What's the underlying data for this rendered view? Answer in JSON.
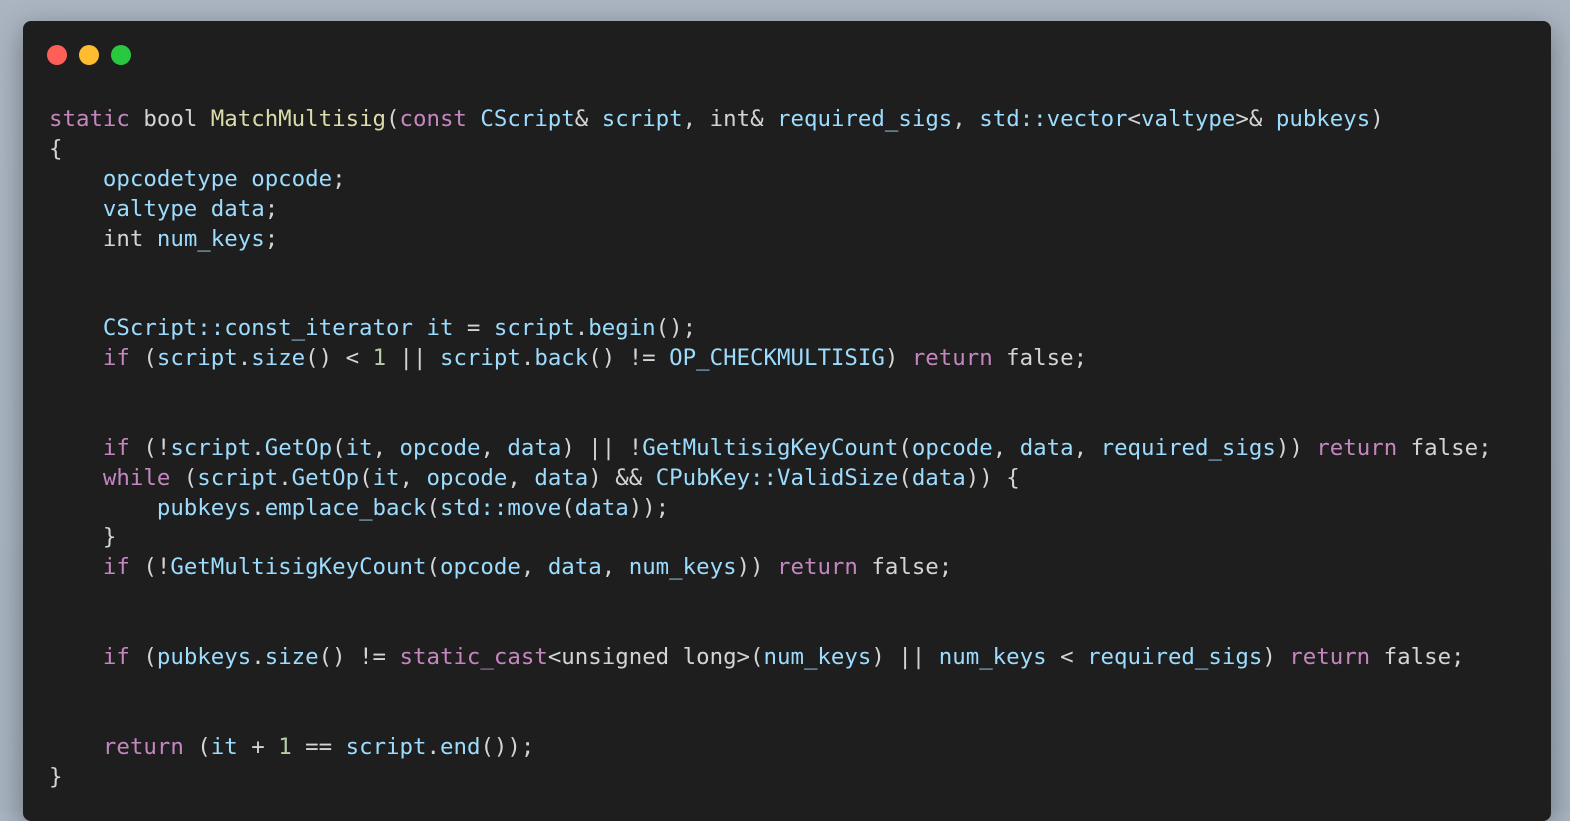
{
  "window": {
    "dots": [
      {
        "name": "close",
        "color": "#ff5f57"
      },
      {
        "name": "minimize",
        "color": "#febc2e"
      },
      {
        "name": "zoom",
        "color": "#28c840"
      }
    ]
  },
  "code": {
    "language": "cpp",
    "lines": [
      [
        [
          "keyword",
          "static"
        ],
        [
          "plain",
          " "
        ],
        [
          "type",
          "bool"
        ],
        [
          "plain",
          " "
        ],
        [
          "func",
          "MatchMultisig"
        ],
        [
          "plain",
          "("
        ],
        [
          "keyword",
          "const"
        ],
        [
          "plain",
          " "
        ],
        [
          "class",
          "CScript"
        ],
        [
          "plain",
          "& "
        ],
        [
          "var",
          "script"
        ],
        [
          "plain",
          ", "
        ],
        [
          "type",
          "int"
        ],
        [
          "plain",
          "& "
        ],
        [
          "var",
          "required_sigs"
        ],
        [
          "plain",
          ", "
        ],
        [
          "class",
          "std::vector"
        ],
        [
          "plain",
          "<"
        ],
        [
          "class",
          "valtype"
        ],
        [
          "plain",
          ">& "
        ],
        [
          "var",
          "pubkeys"
        ],
        [
          "plain",
          ")"
        ]
      ],
      [
        [
          "plain",
          "{"
        ]
      ],
      [
        [
          "plain",
          "    "
        ],
        [
          "class",
          "opcodetype"
        ],
        [
          "plain",
          " "
        ],
        [
          "var",
          "opcode"
        ],
        [
          "plain",
          ";"
        ]
      ],
      [
        [
          "plain",
          "    "
        ],
        [
          "class",
          "valtype"
        ],
        [
          "plain",
          " "
        ],
        [
          "var",
          "data"
        ],
        [
          "plain",
          ";"
        ]
      ],
      [
        [
          "plain",
          "    "
        ],
        [
          "type",
          "int"
        ],
        [
          "plain",
          " "
        ],
        [
          "var",
          "num_keys"
        ],
        [
          "plain",
          ";"
        ]
      ],
      [],
      [],
      [
        [
          "plain",
          "    "
        ],
        [
          "class",
          "CScript::const_iterator"
        ],
        [
          "plain",
          " "
        ],
        [
          "var",
          "it"
        ],
        [
          "plain",
          " = "
        ],
        [
          "var",
          "script"
        ],
        [
          "plain",
          "."
        ],
        [
          "var",
          "begin"
        ],
        [
          "plain",
          "();"
        ]
      ],
      [
        [
          "plain",
          "    "
        ],
        [
          "keyword",
          "if"
        ],
        [
          "plain",
          " ("
        ],
        [
          "var",
          "script"
        ],
        [
          "plain",
          "."
        ],
        [
          "var",
          "size"
        ],
        [
          "plain",
          "() < "
        ],
        [
          "num",
          "1"
        ],
        [
          "plain",
          " || "
        ],
        [
          "var",
          "script"
        ],
        [
          "plain",
          "."
        ],
        [
          "var",
          "back"
        ],
        [
          "plain",
          "() != "
        ],
        [
          "const",
          "OP_CHECKMULTISIG"
        ],
        [
          "plain",
          ") "
        ],
        [
          "keyword",
          "return"
        ],
        [
          "plain",
          " false;"
        ]
      ],
      [],
      [],
      [
        [
          "plain",
          "    "
        ],
        [
          "keyword",
          "if"
        ],
        [
          "plain",
          " (!"
        ],
        [
          "var",
          "script"
        ],
        [
          "plain",
          "."
        ],
        [
          "var",
          "GetOp"
        ],
        [
          "plain",
          "("
        ],
        [
          "var",
          "it"
        ],
        [
          "plain",
          ", "
        ],
        [
          "var",
          "opcode"
        ],
        [
          "plain",
          ", "
        ],
        [
          "var",
          "data"
        ],
        [
          "plain",
          ") || !"
        ],
        [
          "var",
          "GetMultisigKeyCount"
        ],
        [
          "plain",
          "("
        ],
        [
          "var",
          "opcode"
        ],
        [
          "plain",
          ", "
        ],
        [
          "var",
          "data"
        ],
        [
          "plain",
          ", "
        ],
        [
          "var",
          "required_sigs"
        ],
        [
          "plain",
          ")) "
        ],
        [
          "keyword",
          "return"
        ],
        [
          "plain",
          " false;"
        ]
      ],
      [
        [
          "plain",
          "    "
        ],
        [
          "keyword",
          "while"
        ],
        [
          "plain",
          " ("
        ],
        [
          "var",
          "script"
        ],
        [
          "plain",
          "."
        ],
        [
          "var",
          "GetOp"
        ],
        [
          "plain",
          "("
        ],
        [
          "var",
          "it"
        ],
        [
          "plain",
          ", "
        ],
        [
          "var",
          "opcode"
        ],
        [
          "plain",
          ", "
        ],
        [
          "var",
          "data"
        ],
        [
          "plain",
          ") && "
        ],
        [
          "class",
          "CPubKey::ValidSize"
        ],
        [
          "plain",
          "("
        ],
        [
          "var",
          "data"
        ],
        [
          "plain",
          ")) {"
        ]
      ],
      [
        [
          "plain",
          "        "
        ],
        [
          "var",
          "pubkeys"
        ],
        [
          "plain",
          "."
        ],
        [
          "var",
          "emplace_back"
        ],
        [
          "plain",
          "("
        ],
        [
          "var",
          "std::move"
        ],
        [
          "plain",
          "("
        ],
        [
          "var",
          "data"
        ],
        [
          "plain",
          "));"
        ]
      ],
      [
        [
          "plain",
          "    }"
        ]
      ],
      [
        [
          "plain",
          "    "
        ],
        [
          "keyword",
          "if"
        ],
        [
          "plain",
          " (!"
        ],
        [
          "var",
          "GetMultisigKeyCount"
        ],
        [
          "plain",
          "("
        ],
        [
          "var",
          "opcode"
        ],
        [
          "plain",
          ", "
        ],
        [
          "var",
          "data"
        ],
        [
          "plain",
          ", "
        ],
        [
          "var",
          "num_keys"
        ],
        [
          "plain",
          "))"
        ],
        [
          "plain",
          " "
        ],
        [
          "keyword",
          "return"
        ],
        [
          "plain",
          " false;"
        ]
      ],
      [],
      [],
      [
        [
          "plain",
          "    "
        ],
        [
          "keyword",
          "if"
        ],
        [
          "plain",
          " ("
        ],
        [
          "var",
          "pubkeys"
        ],
        [
          "plain",
          "."
        ],
        [
          "var",
          "size"
        ],
        [
          "plain",
          "() != "
        ],
        [
          "keyword",
          "static_cast"
        ],
        [
          "plain",
          "<unsigned long>("
        ],
        [
          "var",
          "num_keys"
        ],
        [
          "plain",
          ") || "
        ],
        [
          "var",
          "num_keys"
        ],
        [
          "plain",
          " < "
        ],
        [
          "var",
          "required_sigs"
        ],
        [
          "plain",
          ") "
        ],
        [
          "keyword",
          "return"
        ],
        [
          "plain",
          " false;"
        ]
      ],
      [],
      [],
      [
        [
          "plain",
          "    "
        ],
        [
          "keyword",
          "return"
        ],
        [
          "plain",
          " ("
        ],
        [
          "var",
          "it"
        ],
        [
          "plain",
          " + "
        ],
        [
          "num",
          "1"
        ],
        [
          "plain",
          " == "
        ],
        [
          "var",
          "script"
        ],
        [
          "plain",
          "."
        ],
        [
          "var",
          "end"
        ],
        [
          "plain",
          "());"
        ]
      ],
      [
        [
          "plain",
          "}"
        ]
      ]
    ]
  }
}
